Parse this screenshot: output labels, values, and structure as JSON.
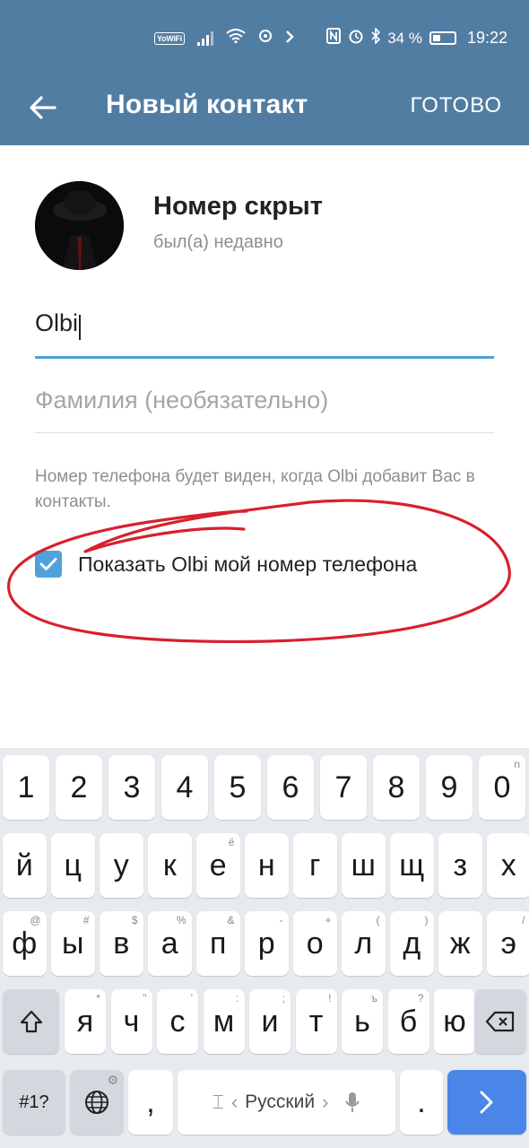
{
  "status_bar": {
    "wifi_badge": "YoWiFi",
    "battery_percent": "34 %",
    "time": "19:22"
  },
  "header": {
    "title": "Новый контакт",
    "done_label": "ГОТОВО"
  },
  "contact": {
    "name": "Номер скрыт",
    "last_seen": "был(а) недавно"
  },
  "form": {
    "first_name_value": "Olbi",
    "last_name_placeholder": "Фамилия (необязательно)"
  },
  "hint_text": "Номер телефона будет виден, когда Olbi добавит Вас в контакты.",
  "share_phone": {
    "label": "Показать Olbi мой номер телефона",
    "checked": true
  },
  "annotation_color": "#d8202e",
  "accent_color": "#4ea3dc",
  "header_color": "#527da3",
  "keyboard": {
    "row_numbers": [
      "1",
      "2",
      "3",
      "4",
      "5",
      "6",
      "7",
      "8",
      "9",
      "0"
    ],
    "row_numbers_sup": [
      "",
      "",
      "",
      "",
      "",
      "",
      "",
      "",
      "",
      "n"
    ],
    "row1": [
      "й",
      "ц",
      "у",
      "к",
      "е",
      "н",
      "г",
      "ш",
      "щ",
      "з",
      "х"
    ],
    "row1_sup": [
      "",
      "",
      "",
      "",
      "ё",
      "",
      "",
      "",
      "",
      "",
      ""
    ],
    "row2": [
      "ф",
      "ы",
      "в",
      "а",
      "п",
      "р",
      "о",
      "л",
      "д",
      "ж",
      "э"
    ],
    "row2_sup": [
      "@",
      "#",
      "$",
      "%",
      "&",
      "-",
      "+",
      "(",
      ")",
      "",
      "/"
    ],
    "row3": [
      "я",
      "ч",
      "с",
      "м",
      "и",
      "т",
      "ь",
      "б",
      "ю"
    ],
    "row3_sup": [
      "*",
      "\"",
      "'",
      ":",
      ";",
      "!",
      "ъ",
      "?",
      ""
    ],
    "symbols_label": "#1?",
    "comma": ",",
    "period": ".",
    "space_label": "Русский",
    "language_icon": "globe-icon",
    "enter_icon": "arrow-right-icon",
    "shift_icon": "shift-icon",
    "backspace_icon": "backspace-icon",
    "mic_icon": "mic-icon"
  }
}
